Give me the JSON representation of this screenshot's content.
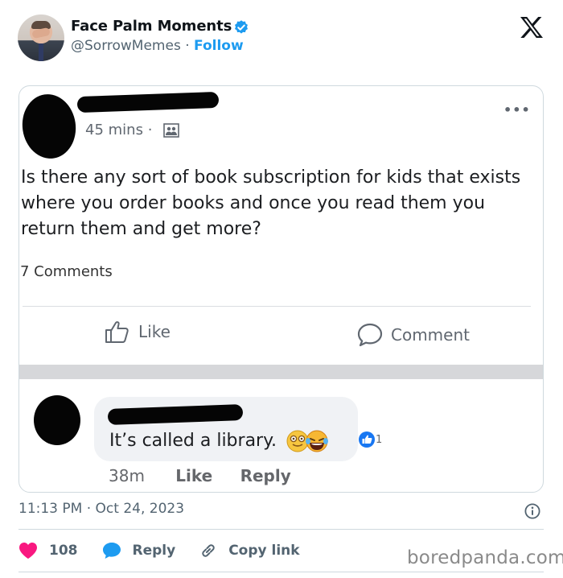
{
  "author": {
    "name": "Face Palm Moments",
    "handle": "@SorrowMemes",
    "separator": "·",
    "follow_label": "Follow",
    "verified_icon": "verified-badge-icon",
    "brand_icon": "x-logo-icon"
  },
  "embedded_post": {
    "time": "45 mins",
    "time_sep": "·",
    "audience_icon": "group-icon",
    "more_icon": "more-options-icon",
    "more_label": "•••",
    "body": "Is there any sort of book subscription for kids that exists where you order books and once you read them you return them and get more?",
    "comments_count": "7 Comments",
    "like_label": "Like",
    "comment_label": "Comment",
    "reply": {
      "text": "It’s called a library.",
      "reaction_count": "1",
      "time": "38m",
      "like_label": "Like",
      "reply_label": "Reply"
    }
  },
  "tweet": {
    "timestamp": "11:13 PM · Oct 24, 2023",
    "likes": "108",
    "reply_label": "Reply",
    "copy_link_label": "Copy link"
  },
  "watermark": "boredpanda.com",
  "colors": {
    "accent": "#1d9bf0",
    "like_heart": "#f91880",
    "muted": "#536471"
  }
}
